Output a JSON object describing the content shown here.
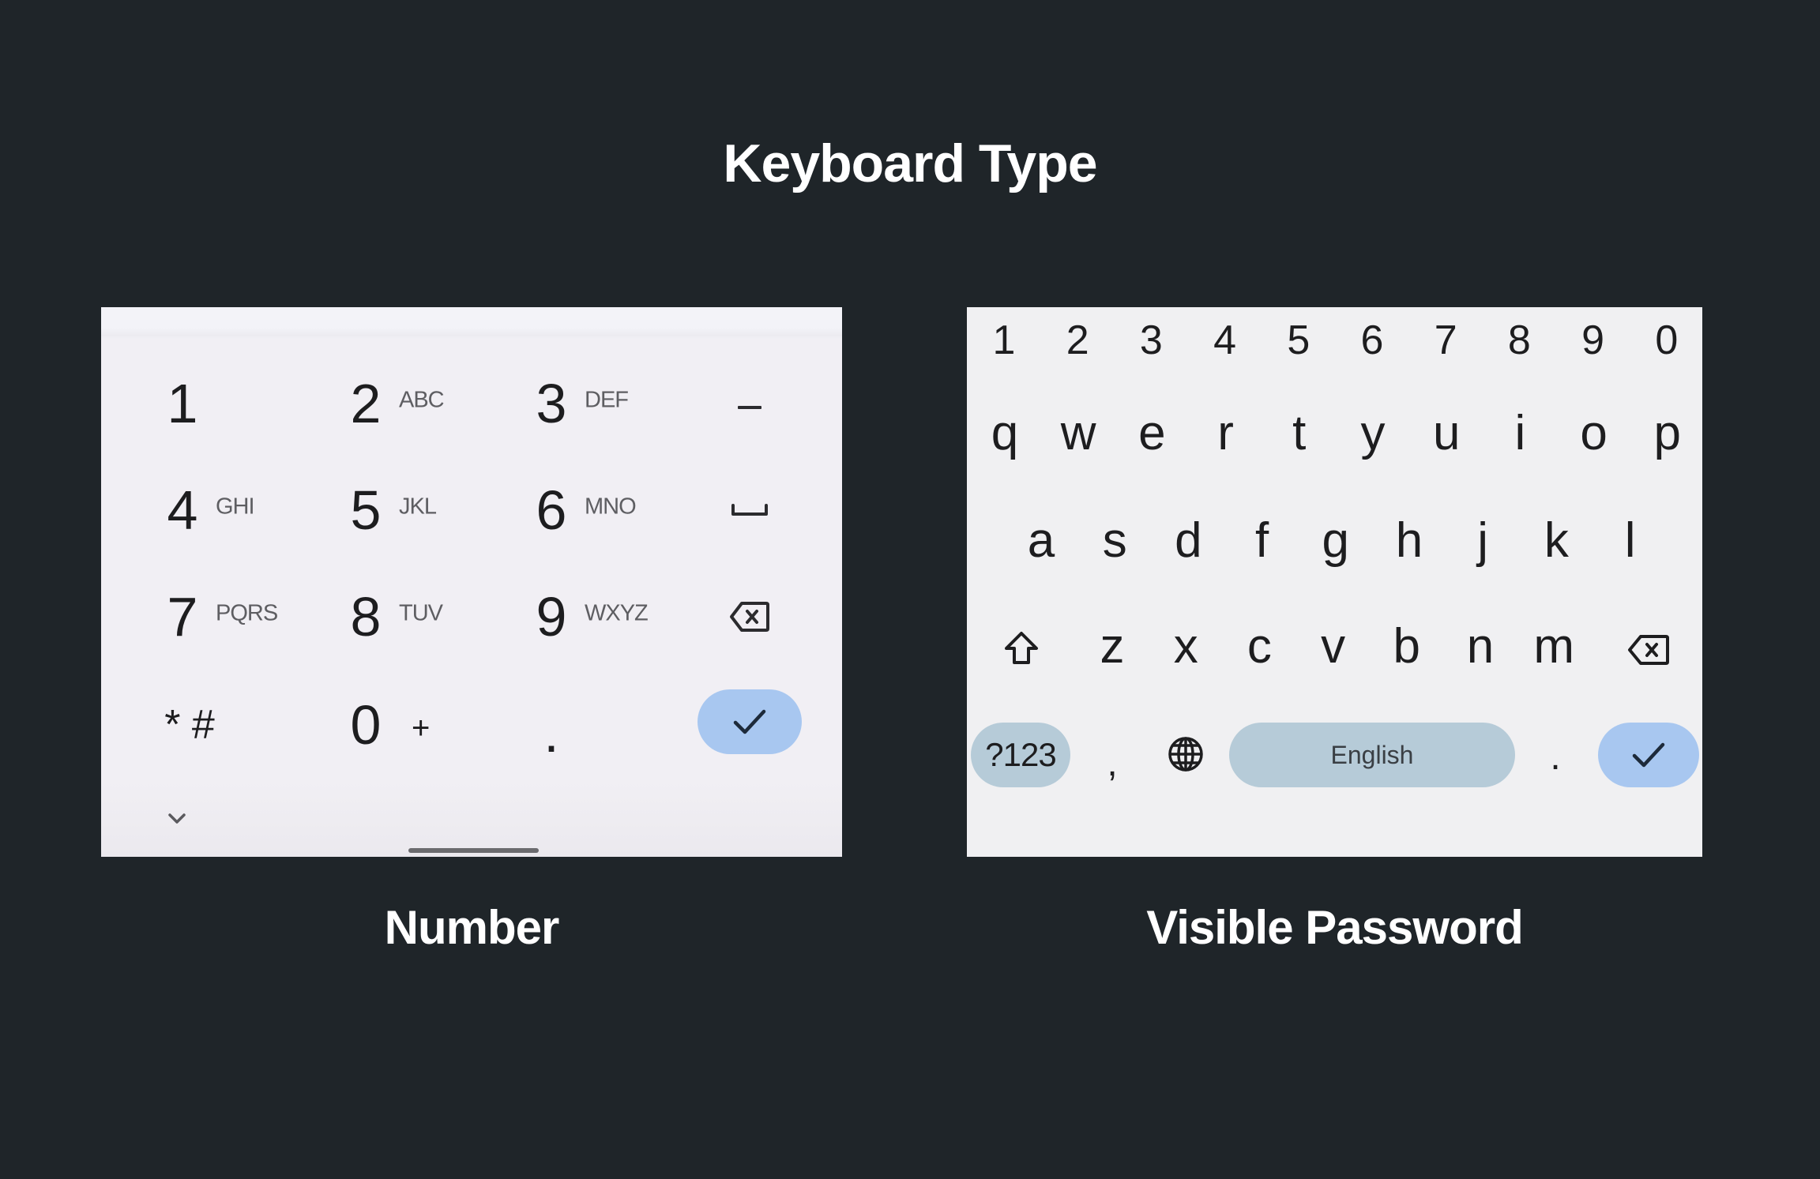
{
  "title": "Keyboard Type",
  "colors": {
    "background": "#1f2529",
    "done_button": "#a8c7f0",
    "pill_key": "#b6cbd8"
  },
  "number_keyboard": {
    "caption": "Number",
    "rows": [
      [
        {
          "digit": "1",
          "sub": ""
        },
        {
          "digit": "2",
          "sub": "ABC"
        },
        {
          "digit": "3",
          "sub": "DEF"
        }
      ],
      [
        {
          "digit": "4",
          "sub": "GHI"
        },
        {
          "digit": "5",
          "sub": "JKL"
        },
        {
          "digit": "6",
          "sub": "MNO"
        }
      ],
      [
        {
          "digit": "7",
          "sub": "PQRS"
        },
        {
          "digit": "8",
          "sub": "TUV"
        },
        {
          "digit": "9",
          "sub": "WXYZ"
        }
      ],
      [
        {
          "digit": "* #",
          "sub": ""
        },
        {
          "digit": "0",
          "sub": "+"
        },
        {
          "digit": ".",
          "sub": ""
        }
      ]
    ],
    "side_keys": [
      "minus-icon",
      "space-icon",
      "backspace-icon",
      "done-check-icon"
    ],
    "minus_label": "–",
    "collapse_icon": "chevron-down-icon"
  },
  "password_keyboard": {
    "caption": "Visible Password",
    "number_row": [
      "1",
      "2",
      "3",
      "4",
      "5",
      "6",
      "7",
      "8",
      "9",
      "0"
    ],
    "row1": [
      "q",
      "w",
      "e",
      "r",
      "t",
      "y",
      "u",
      "i",
      "o",
      "p"
    ],
    "row2": [
      "a",
      "s",
      "d",
      "f",
      "g",
      "h",
      "j",
      "k",
      "l"
    ],
    "row3": [
      "z",
      "x",
      "c",
      "v",
      "b",
      "n",
      "m"
    ],
    "symbols_key": "?123",
    "comma_key": ",",
    "space_label": "English",
    "period_key": "."
  }
}
